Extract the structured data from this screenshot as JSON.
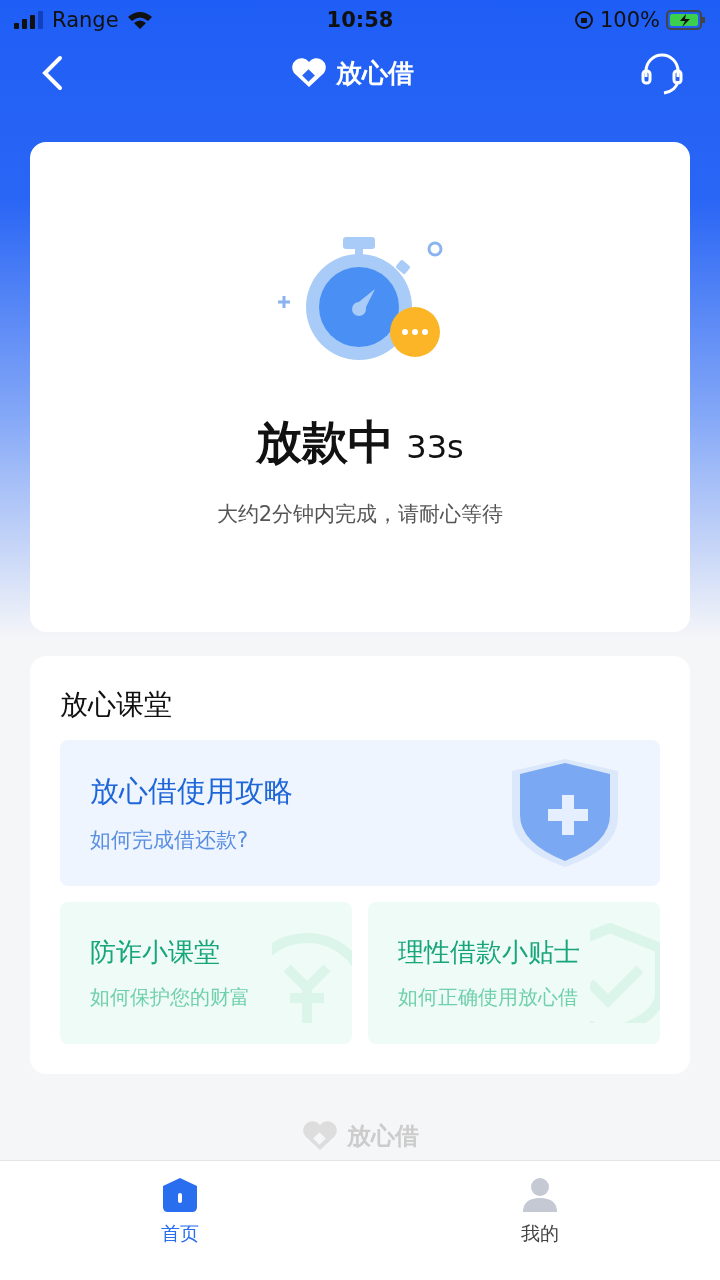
{
  "status_bar": {
    "carrier": "Range",
    "time": "10:58",
    "battery": "100%"
  },
  "nav": {
    "title": "放心借"
  },
  "status_card": {
    "title": "放款中",
    "countdown": "33s",
    "note": "大约2分钟内完成，请耐心等待"
  },
  "classroom": {
    "title": "放心课堂",
    "main": {
      "title": "放心借使用攻略",
      "subtitle": "如何完成借还款?"
    },
    "tiles": [
      {
        "kind": "coin",
        "title": "防诈小课堂",
        "subtitle": "如何保护您的财富"
      },
      {
        "kind": "shield",
        "title": "理性借款小贴士",
        "subtitle": "如何正确使用放心借"
      }
    ]
  },
  "footer": {
    "brand": "放心借"
  },
  "tab_bar": [
    {
      "kind": "home",
      "label": "首页",
      "selected": true
    },
    {
      "kind": "person",
      "label": "我的",
      "selected": false
    }
  ]
}
